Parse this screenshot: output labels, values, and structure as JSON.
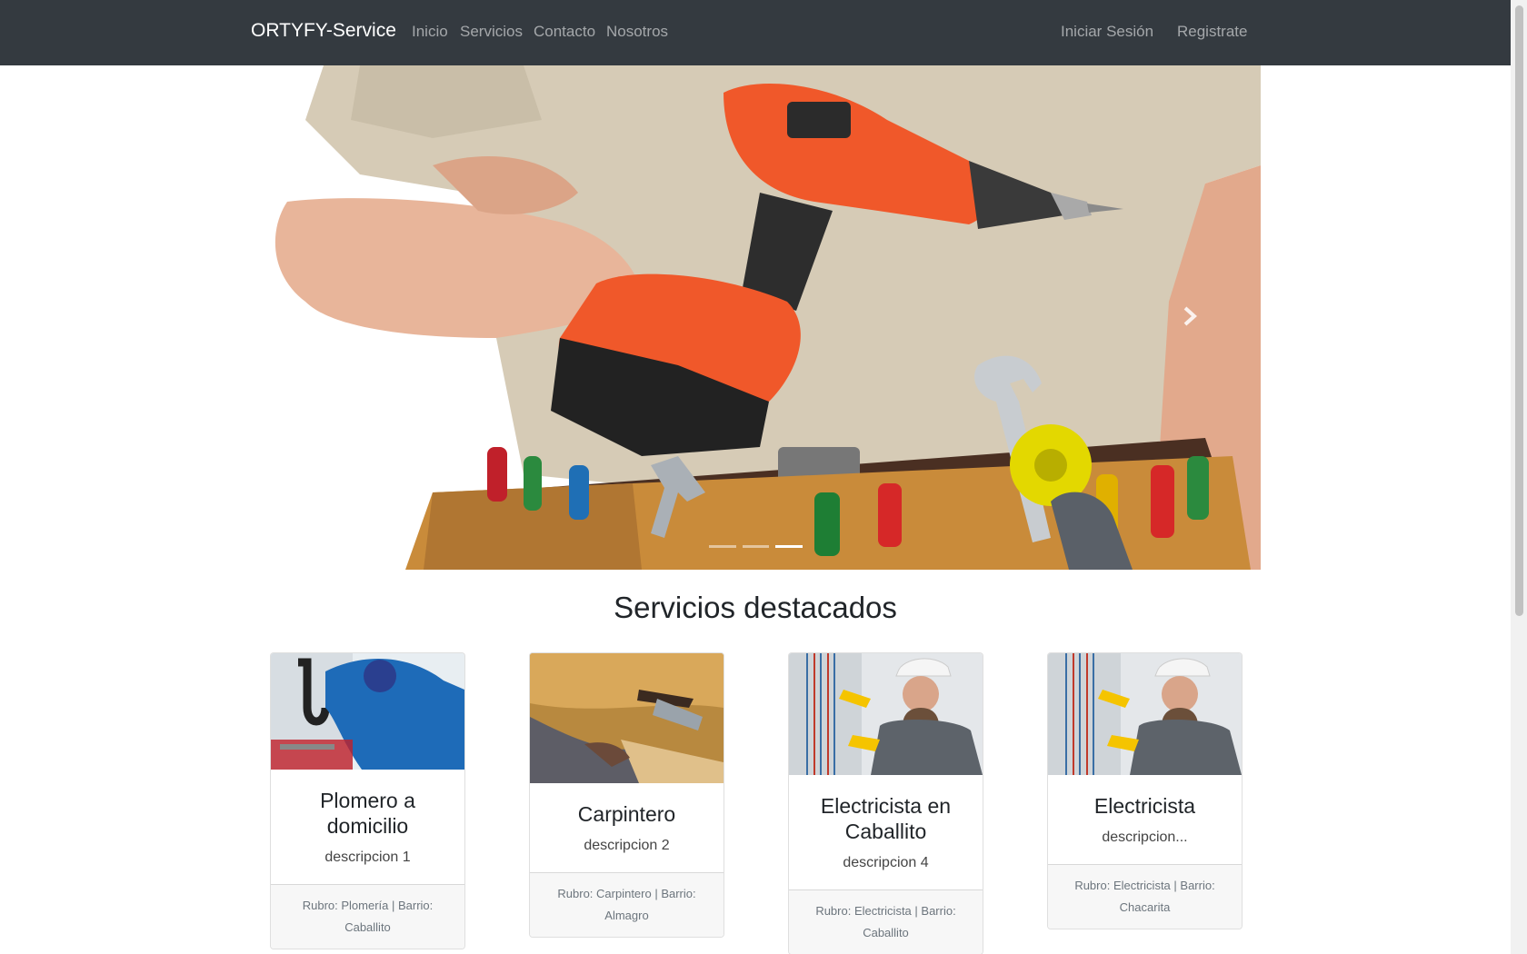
{
  "navbar": {
    "brand": "ORTYFY-Service",
    "links": [
      "Inicio",
      "Servicios",
      "Contacto",
      "Nosotros"
    ],
    "login": "Iniciar Sesión",
    "register": "Registrate"
  },
  "carousel": {
    "slide_count": 3,
    "active_slide": 3,
    "next_icon": "chevron-right-icon"
  },
  "section": {
    "title": "Servicios destacados"
  },
  "cards": [
    {
      "title": "Plomero a domicilio",
      "description": "descripcion 1",
      "footer": "Rubro: Plomería | Barrio: Caballito"
    },
    {
      "title": "Carpintero",
      "description": "descripcion 2",
      "footer": "Rubro: Carpintero | Barrio: Almagro"
    },
    {
      "title": "Electricista en Caballito",
      "description": "descripcion 4",
      "footer": "Rubro: Electricista | Barrio: Caballito"
    },
    {
      "title": "Electricista",
      "description": "descripcion...",
      "footer": "Rubro: Electricista | Barrio: Chacarita"
    }
  ],
  "colors": {
    "navbar_bg": "#343a40",
    "drill_orange": "#f0582a",
    "belt_brown": "#c98b3a"
  }
}
